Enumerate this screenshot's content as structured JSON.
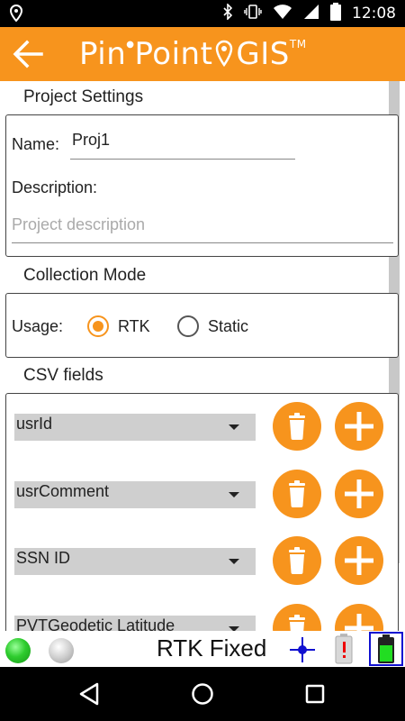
{
  "statusbar": {
    "time": "12:08"
  },
  "appbar": {
    "title_part1": "Pin",
    "title_part2": "Point",
    "title_part3": "GIS",
    "trademark": "TM"
  },
  "project_settings": {
    "section_title": "Project Settings",
    "name_label": "Name:",
    "name_value": "Proj1",
    "description_label": "Description:",
    "description_placeholder": "Project description"
  },
  "collection_mode": {
    "section_title": "Collection Mode",
    "usage_label": "Usage:",
    "options": [
      {
        "label": "RTK",
        "selected": true
      },
      {
        "label": "Static",
        "selected": false
      }
    ]
  },
  "csv_fields": {
    "section_title": "CSV fields",
    "rows": [
      {
        "field": "usrId"
      },
      {
        "field": "usrComment"
      },
      {
        "field": "SSN ID"
      },
      {
        "field": "PVTGeodetic Latitude"
      }
    ]
  },
  "bottom_status": {
    "fix_status": "RTK Fixed",
    "indicator_colors": {
      "led1": "#2ecc2e",
      "led2": "#c8c8c8"
    },
    "icons": [
      "crosshair-icon",
      "battery-warning-icon",
      "battery-full-icon"
    ]
  },
  "colors": {
    "accent": "#F7941D",
    "nav_bg": "#000000"
  }
}
